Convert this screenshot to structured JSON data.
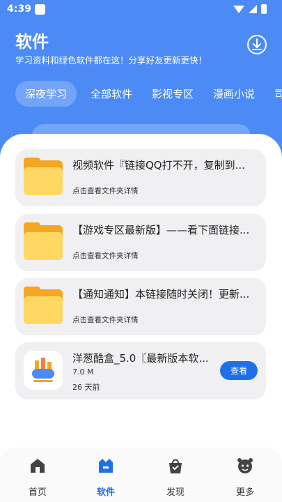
{
  "status_bar": {
    "time": "4:39"
  },
  "header": {
    "title": "软件",
    "subtitle": "学习资料和绿色软件都在这！分享好友更新更快！"
  },
  "tabs": [
    {
      "label": "深夜学习",
      "active": true
    },
    {
      "label": "全部软件",
      "active": false
    },
    {
      "label": "影视专区",
      "active": false
    },
    {
      "label": "漫画小说",
      "active": false
    },
    {
      "label": "司",
      "active": false
    }
  ],
  "folders": [
    {
      "title": "视频软件『链接QQ打不开，复制到...",
      "subtitle": "点击查看文件夹详情"
    },
    {
      "title": "【游戏专区最新版】——看下面链接...",
      "subtitle": "点击查看文件夹详情"
    },
    {
      "title": "【通知通知】本链接随时关闭！更新...",
      "subtitle": "点击查看文件夹详情"
    }
  ],
  "app": {
    "title": "洋葱酷盒_5.0〖最新版本软...",
    "size": "7.0 M",
    "time": "26 天前",
    "button": "查看"
  },
  "bottom_nav": [
    {
      "label": "首页",
      "icon": "home-icon",
      "active": false
    },
    {
      "label": "软件",
      "icon": "software-icon",
      "active": true
    },
    {
      "label": "发现",
      "icon": "bag-icon",
      "active": false
    },
    {
      "label": "更多",
      "icon": "more-icon",
      "active": false
    }
  ],
  "colors": {
    "primary": "#4c8bf5",
    "button": "#1f6fe8",
    "folder": "#ffd864",
    "card_bg": "#f0f0f2"
  }
}
